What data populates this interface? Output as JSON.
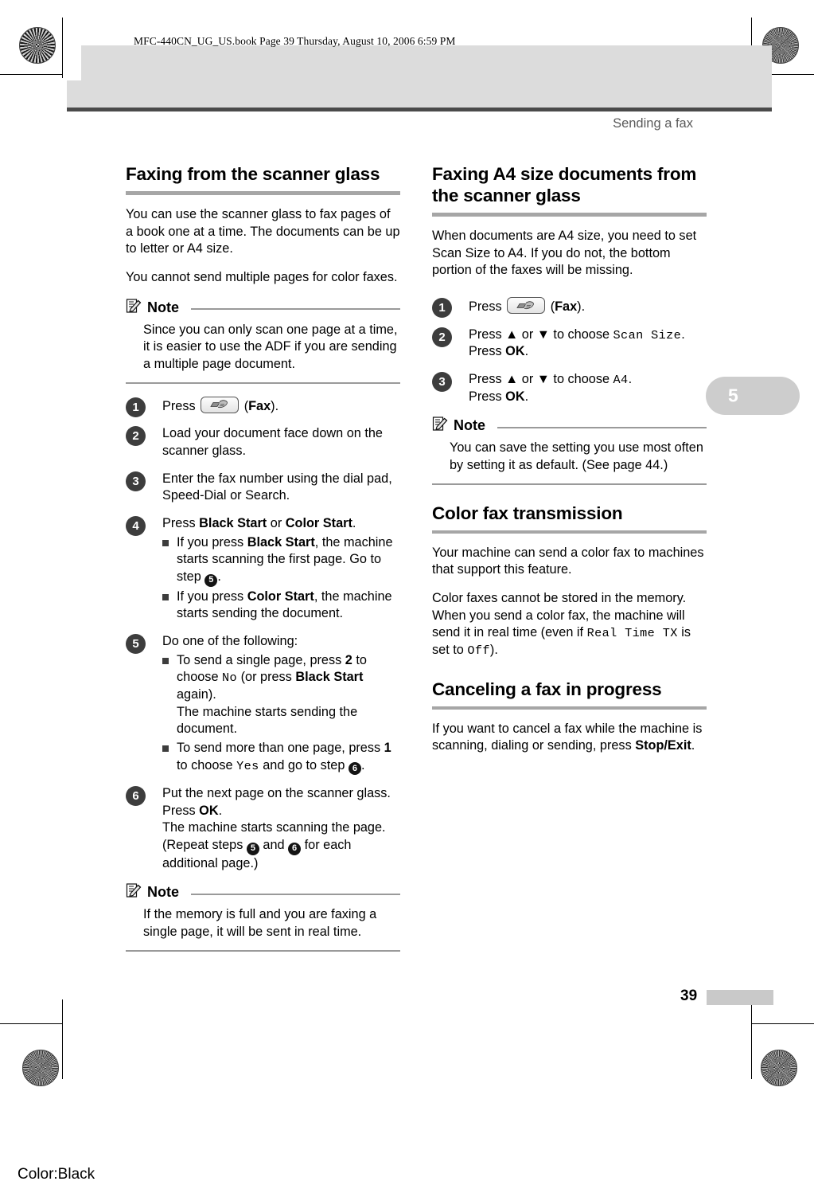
{
  "print_marks": {
    "file_stamp": "MFC-440CN_UG_US.book  Page 39  Thursday, August 10, 2006  6:59 PM",
    "color_plate": "Color:Black"
  },
  "header": {
    "running_head": "Sending a fax"
  },
  "chapter_tab": {
    "number": "5"
  },
  "footer": {
    "page_number": "39"
  },
  "left_column": {
    "section1": {
      "heading": "Faxing from the scanner glass",
      "para1": "You can use the scanner glass to fax pages of a book one at a time. The documents can be up to letter or A4 size.",
      "para2": "You cannot send multiple pages for color faxes.",
      "note1": {
        "title": "Note",
        "body": "Since you can only scan one page at a time, it is easier to use the ADF if you are sending a multiple page document."
      },
      "steps": {
        "s1_pre": "Press",
        "s1_key": "fax-key",
        "s1_post": "(Fax).",
        "s2": "Load your document face down on the scanner glass.",
        "s3": "Enter the fax number using the dial pad, Speed-Dial or Search.",
        "s4_lead_a": "Press ",
        "s4_lead_b": "Black Start",
        "s4_lead_c": " or ",
        "s4_lead_d": "Color Start",
        "s4_lead_e": ".",
        "s4_b1_a": "If you press ",
        "s4_b1_b": "Black Start",
        "s4_b1_c": ", the machine starts scanning the first page. Go to step ",
        "s4_b1_ref": "5",
        "s4_b1_d": ".",
        "s4_b2_a": "If you press ",
        "s4_b2_b": "Color Start",
        "s4_b2_c": ", the machine starts sending the document.",
        "s5_lead": "Do one of the following:",
        "s5_b1_a": "To send a single page, press ",
        "s5_b1_b": "2",
        "s5_b1_c": " to choose ",
        "s5_b1_mono": "No",
        "s5_b1_d": " (or press ",
        "s5_b1_e": "Black Start",
        "s5_b1_f": " again).",
        "s5_b1_g": "The machine starts sending the document.",
        "s5_b2_a": "To send more than one page, press ",
        "s5_b2_b": "1",
        "s5_b2_c": " to choose ",
        "s5_b2_mono": "Yes",
        "s5_b2_d": " and go to step ",
        "s5_b2_ref": "6",
        "s5_b2_e": ".",
        "s6_a": "Put the next page on the scanner glass. Press ",
        "s6_b": "OK",
        "s6_c": ".",
        "s6_d": "The machine starts scanning the page. (Repeat steps ",
        "s6_ref1": "5",
        "s6_e": " and ",
        "s6_ref2": "6",
        "s6_f": " for each additional page.)"
      },
      "note2": {
        "title": "Note",
        "body": "If the memory is full and you are faxing a single page, it will be sent in real time."
      }
    }
  },
  "right_column": {
    "section1": {
      "heading": "Faxing A4 size documents from the scanner glass",
      "para1": "When documents are A4 size, you need to set Scan Size to A4. If you do not, the bottom portion of the faxes will be missing.",
      "steps": {
        "s1_pre": "Press",
        "s1_post": "(Fax).",
        "s2_a": "Press ▲ or ▼ to choose ",
        "s2_mono": "Scan Size",
        "s2_b": ".",
        "s2_c": "Press ",
        "s2_d": "OK",
        "s2_e": ".",
        "s3_a": "Press ▲ or ▼ to choose ",
        "s3_mono": "A4",
        "s3_b": ".",
        "s3_c": "Press ",
        "s3_d": "OK",
        "s3_e": "."
      },
      "note1": {
        "title": "Note",
        "body": "You can save the setting you use most often by setting it as default. (See page 44.)"
      }
    },
    "section2": {
      "heading": "Color fax transmission",
      "para1": "Your machine can send a color fax to machines that support this feature.",
      "para2_a": "Color faxes cannot be stored in the memory. When you send a color fax, the machine will send it in real time (even if ",
      "para2_mono1": "Real Time TX",
      "para2_b": " is set to ",
      "para2_mono2": "Off",
      "para2_c": ")."
    },
    "section3": {
      "heading": "Canceling a fax in progress",
      "para1_a": "If you want to cancel a fax while the machine is scanning, dialing or sending, press ",
      "para1_b": "Stop/Exit",
      "para1_c": "."
    }
  }
}
